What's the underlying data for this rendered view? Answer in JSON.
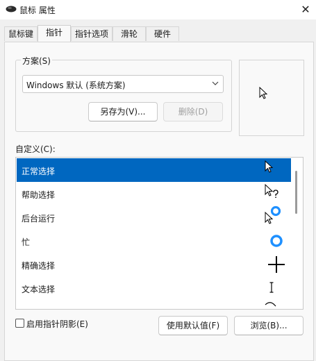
{
  "window": {
    "title": "鼠标 属性",
    "close_label": "✕"
  },
  "tabs": [
    {
      "label": "鼠标键",
      "active": false
    },
    {
      "label": "指针",
      "active": true
    },
    {
      "label": "指针选项",
      "active": false
    },
    {
      "label": "滑轮",
      "active": false
    },
    {
      "label": "硬件",
      "active": false
    }
  ],
  "scheme": {
    "group_label": "方案(S)",
    "selected": "Windows 默认 (系统方案)",
    "save_as_label": "另存为(V)...",
    "delete_label": "删除(D)"
  },
  "custom": {
    "label": "自定义(C):",
    "items": [
      {
        "label": "正常选择",
        "icon": "arrow-cursor-icon",
        "selected": true
      },
      {
        "label": "帮助选择",
        "icon": "help-cursor-icon",
        "selected": false
      },
      {
        "label": "后台运行",
        "icon": "working-in-background-cursor-icon",
        "selected": false
      },
      {
        "label": "忙",
        "icon": "busy-cursor-icon",
        "selected": false
      },
      {
        "label": "精确选择",
        "icon": "precision-cross-cursor-icon",
        "selected": false
      },
      {
        "label": "文本选择",
        "icon": "text-ibeam-cursor-icon",
        "selected": false
      },
      {
        "label": "",
        "icon": "handwriting-cursor-icon",
        "selected": false
      }
    ]
  },
  "options": {
    "shadow_label": "启用指针阴影(E)",
    "shadow_checked": false
  },
  "buttons": {
    "use_default_label": "使用默认值(F)",
    "browse_label": "浏览(B)..."
  },
  "colors": {
    "selection": "#0067c0",
    "busy_ring": "#1e90ff"
  }
}
